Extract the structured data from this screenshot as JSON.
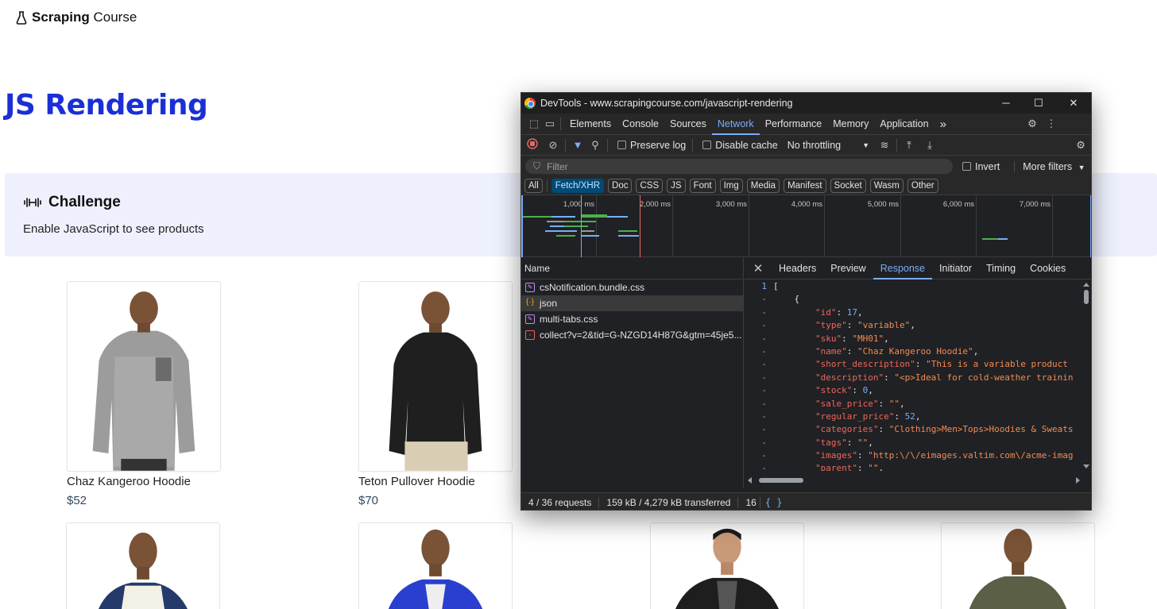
{
  "site": {
    "logo_bold": "Scraping",
    "logo_rest": " Course",
    "page_title": "JS Rendering",
    "challenge": {
      "title": "Challenge",
      "text": "Enable JavaScript to see products"
    },
    "products": [
      {
        "name": "Chaz Kangeroo Hoodie",
        "price": "$52"
      },
      {
        "name": "Teton Pullover Hoodie",
        "price": "$70"
      }
    ]
  },
  "devtools": {
    "window_title": "DevTools - www.scrapingcourse.com/javascript-rendering",
    "window_controls": {
      "minimize": "─",
      "maximize": "☐",
      "close": "✕"
    },
    "tabs": [
      "Elements",
      "Console",
      "Sources",
      "Network",
      "Performance",
      "Memory",
      "Application"
    ],
    "active_tab": "Network",
    "more_tabs": "»",
    "toolbar": {
      "preserve_log": "Preserve log",
      "disable_cache": "Disable cache",
      "throttling": "No throttling"
    },
    "filter": {
      "placeholder": "Filter",
      "invert": "Invert",
      "more_filters": "More filters"
    },
    "type_filters": [
      "All",
      "Fetch/XHR",
      "Doc",
      "CSS",
      "JS",
      "Font",
      "Img",
      "Media",
      "Manifest",
      "Socket",
      "Wasm",
      "Other"
    ],
    "active_type_filter": "Fetch/XHR",
    "timeline_ticks": [
      "1,000 ms",
      "2,000 ms",
      "3,000 ms",
      "4,000 ms",
      "5,000 ms",
      "6,000 ms",
      "7,000 ms"
    ],
    "requests_header": "Name",
    "requests": [
      {
        "name": "csNotification.bundle.css",
        "type": "css"
      },
      {
        "name": "json",
        "type": "json"
      },
      {
        "name": "multi-tabs.css",
        "type": "css"
      },
      {
        "name": "collect?v=2&tid=G-NZGD14H87G&gtm=45je5...",
        "type": "img"
      }
    ],
    "detail_tabs": [
      "Headers",
      "Preview",
      "Response",
      "Initiator",
      "Timing",
      "Cookies"
    ],
    "active_detail_tab": "Response",
    "response_lines": [
      {
        "ln": "1",
        "text": "["
      },
      {
        "ln": "-",
        "text": "    {"
      },
      {
        "ln": "-",
        "key": "\"id\"",
        "val": "17",
        "vtype": "n"
      },
      {
        "ln": "-",
        "key": "\"type\"",
        "val": "\"variable\"",
        "vtype": "s"
      },
      {
        "ln": "-",
        "key": "\"sku\"",
        "val": "\"MH01\"",
        "vtype": "s"
      },
      {
        "ln": "-",
        "key": "\"name\"",
        "val": "\"Chaz Kangeroo Hoodie\"",
        "vtype": "s"
      },
      {
        "ln": "-",
        "key": "\"short_description\"",
        "val": "\"This is a variable product",
        "vtype": "s",
        "cut": true
      },
      {
        "ln": "-",
        "key": "\"description\"",
        "val": "\"<p>Ideal for cold-weather trainin",
        "vtype": "s",
        "cut": true
      },
      {
        "ln": "-",
        "key": "\"stock\"",
        "val": "0",
        "vtype": "n"
      },
      {
        "ln": "-",
        "key": "\"sale_price\"",
        "val": "\"\"",
        "vtype": "s"
      },
      {
        "ln": "-",
        "key": "\"regular_price\"",
        "val": "52",
        "vtype": "n"
      },
      {
        "ln": "-",
        "key": "\"categories\"",
        "val": "\"Clothing>Men>Tops>Hoodies & Sweats",
        "vtype": "s",
        "cut": true
      },
      {
        "ln": "-",
        "key": "\"tags\"",
        "val": "\"\"",
        "vtype": "s"
      },
      {
        "ln": "-",
        "key": "\"images\"",
        "val": "\"http:\\/\\/eimages.valtim.com\\/acme-imag",
        "vtype": "s",
        "cut": true
      },
      {
        "ln": "-",
        "key": "\"parent\"",
        "val": "\"\"",
        "vtype": "s"
      }
    ],
    "status": {
      "requests": "4 / 36 requests",
      "transferred": "159 kB / 4,279 kB transferred",
      "resources_cut": "16",
      "format_icon": "{ }"
    },
    "colors": {
      "accent": "#7cacf8",
      "record": "#e46962",
      "json_key": "#ee675c",
      "json_string": "#f28b54",
      "json_number": "#7cacf8"
    }
  }
}
